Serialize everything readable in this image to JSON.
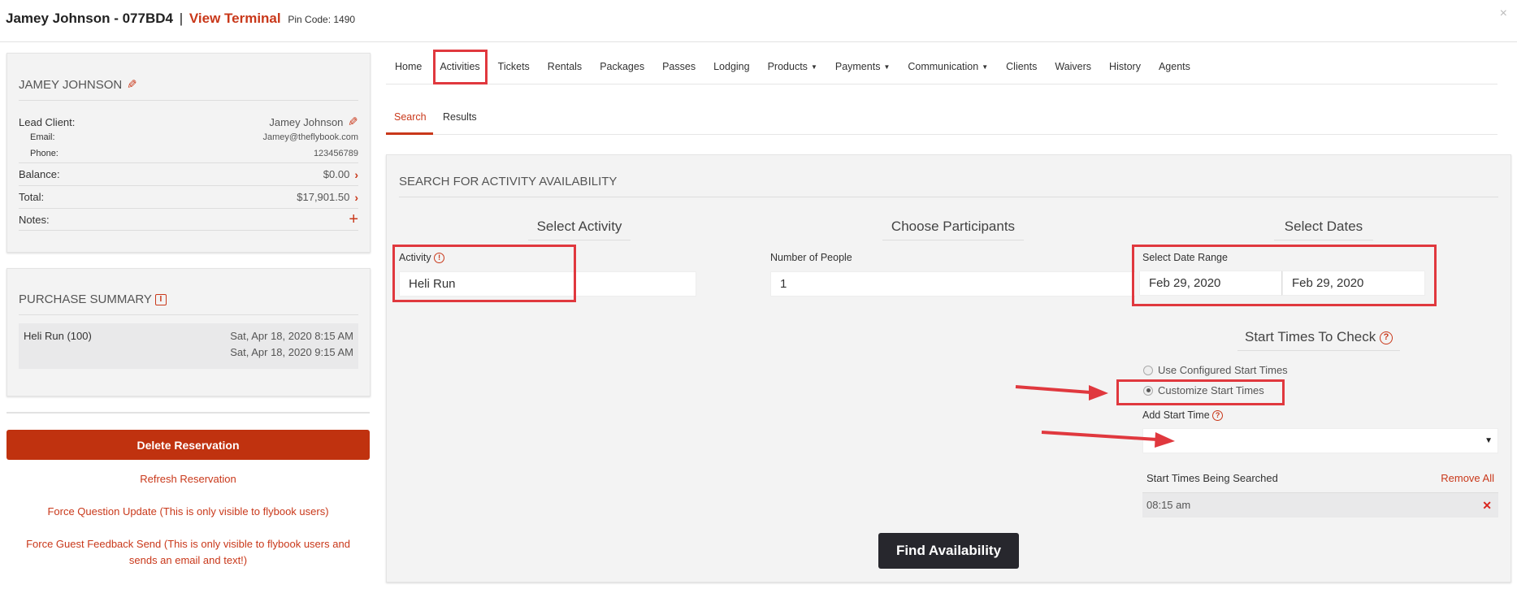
{
  "header": {
    "name": "Jamey Johnson - 077BD4",
    "separator": "|",
    "view_terminal": "View Terminal",
    "pin_code": "Pin Code: 1490",
    "close": "×"
  },
  "client": {
    "heading": "JAMEY JOHNSON",
    "lead_client_label": "Lead Client:",
    "lead_client_value": "Jamey Johnson",
    "email_label": "Email:",
    "email_value": "Jamey@theflybook.com",
    "phone_label": "Phone:",
    "phone_value": "123456789",
    "balance_label": "Balance:",
    "balance_value": "$0.00",
    "total_label": "Total:",
    "total_value": "$17,901.50",
    "notes_label": "Notes:"
  },
  "purchase_summary": {
    "heading": "PURCHASE SUMMARY",
    "info_icon": "i",
    "item_name": "Heli Run (100)",
    "item_time_1": "Sat, Apr 18, 2020 8:15 AM",
    "item_time_2": "Sat, Apr 18, 2020 9:15 AM"
  },
  "actions": {
    "delete": "Delete Reservation",
    "refresh": "Refresh Reservation",
    "force_question": "Force Question Update (This is only visible to flybook users)",
    "force_feedback_1": "Force Guest Feedback Send (This is only visible to flybook users and",
    "force_feedback_2": "sends an email and text!)"
  },
  "nav": {
    "items": [
      "Home",
      "Activities",
      "Tickets",
      "Rentals",
      "Packages",
      "Passes",
      "Lodging",
      "Products",
      "Payments",
      "Communication",
      "Clients",
      "Waivers",
      "History",
      "Agents"
    ],
    "active": "Activities"
  },
  "subtabs": {
    "search": "Search",
    "results": "Results"
  },
  "search": {
    "heading": "SEARCH FOR ACTIVITY AVAILABILITY",
    "select_activity_title": "Select Activity",
    "choose_participants_title": "Choose Participants",
    "select_dates_title": "Select Dates",
    "activity_label": "Activity",
    "activity_value": "Heli Run",
    "people_label": "Number of People",
    "people_value": "1",
    "date_range_label": "Select Date Range",
    "date_from": "Feb 29, 2020",
    "date_to": "Feb 29, 2020",
    "start_times_title": "Start Times To Check",
    "use_configured": "Use Configured Start Times",
    "customize": "Customize Start Times",
    "add_start_time_label": "Add Start Time",
    "times_being_searched": "Start Times Being Searched",
    "remove_all": "Remove All",
    "time_1": "08:15 am",
    "find_button": "Find Availability"
  },
  "colors": {
    "accent": "#c9381a",
    "annotation_red": "#e0383e",
    "delete_button": "#c0320f",
    "find_button": "#27272d"
  }
}
